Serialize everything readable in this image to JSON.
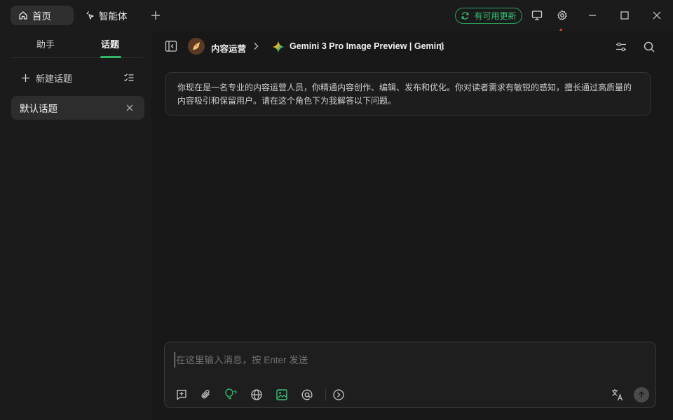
{
  "topbar": {
    "tabs": [
      {
        "label": "首页",
        "icon": "home-icon"
      },
      {
        "label": "智能体",
        "icon": "sparkle-cursor-icon"
      }
    ],
    "update_label": "有可用更新",
    "accent_green": "#35c472"
  },
  "sidebar": {
    "tabs": [
      {
        "label": "助手"
      },
      {
        "label": "话题",
        "active": true
      }
    ],
    "new_topic_label": "新建话题",
    "topics": [
      {
        "label": "默认话题"
      }
    ]
  },
  "main": {
    "assistant_name": "内容运营",
    "model_name": "Gemini 3 Pro Image Preview | Gemini",
    "system_prompt": "你现在是一名专业的内容运营人员，你精通内容创作、编辑、发布和优化。你对读者需求有敏锐的感知，擅长通过高质量的内容吸引和保留用户。请在这个角色下为我解答以下问题。",
    "input": {
      "placeholder": "在这里输入消息，按 Enter 发送",
      "value": ""
    },
    "toolbar_icons": [
      "new-topic-icon",
      "paperclip-icon",
      "lightbulb-icon",
      "globe-icon",
      "image-icon",
      "at-icon",
      "chevron-right-circle-icon",
      "translate-icon",
      "send-arrow-icon"
    ]
  },
  "annotation": {
    "color": "#ff4a4a"
  }
}
